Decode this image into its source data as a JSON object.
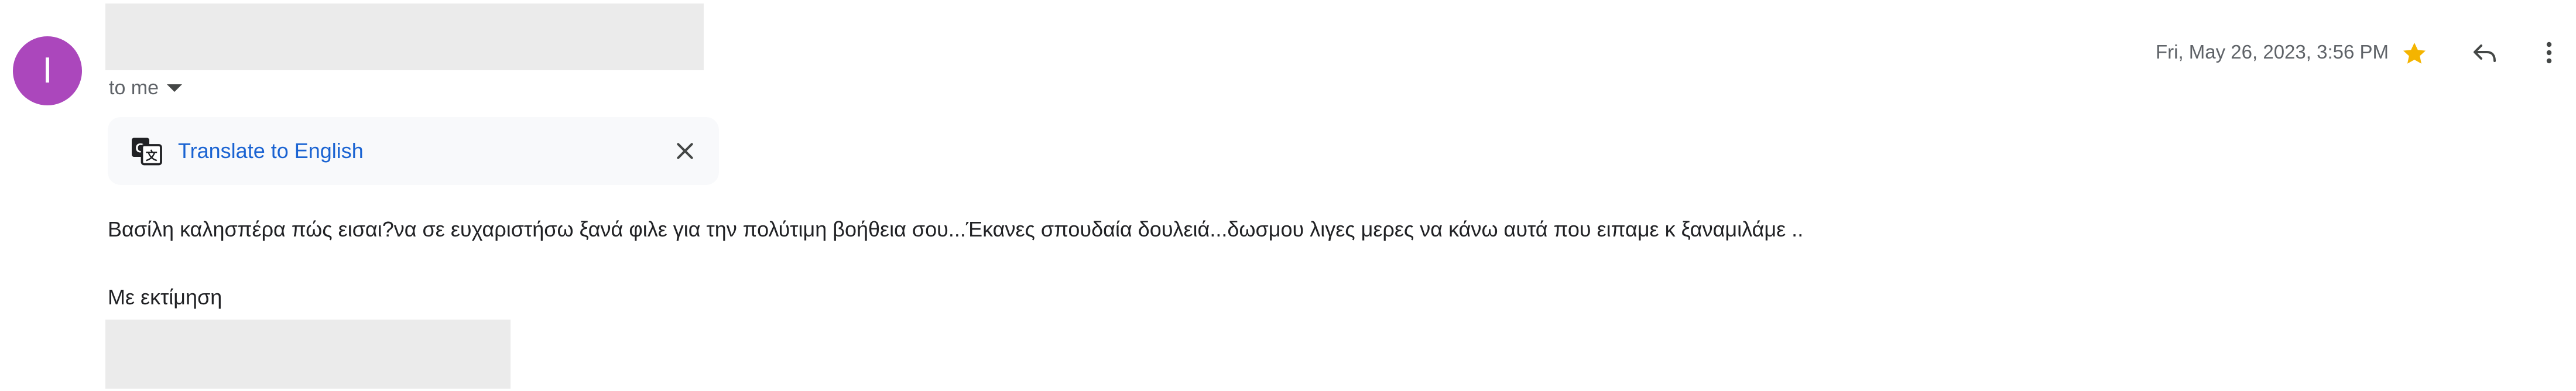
{
  "sender": {
    "avatar_initial": "I",
    "avatar_color": "#ab47bc"
  },
  "recipient": {
    "label": "to me"
  },
  "translate": {
    "label": "Translate to English",
    "link_color": "#1a63d2",
    "icon": "translate-icon",
    "close_icon": "close-icon"
  },
  "header": {
    "date": "Fri, May 26, 2023, 3:56 PM",
    "star_color": "#f4b400",
    "actions": [
      "star-icon",
      "reply-icon",
      "more-vert-icon"
    ]
  },
  "message": {
    "body": "Βασίλη καλησπέρα πώς εισαι?να σε ευχαριστήσω ξανά φιλε για την πολύτιμη βοήθεια σου...Έκανες σπουδαία δουλειά...δωσμου λιγες μερες να κάνω αυτά που ειπαμε κ ξαναμιλάμε ..",
    "sign_off": "Με εκτίμηση"
  }
}
